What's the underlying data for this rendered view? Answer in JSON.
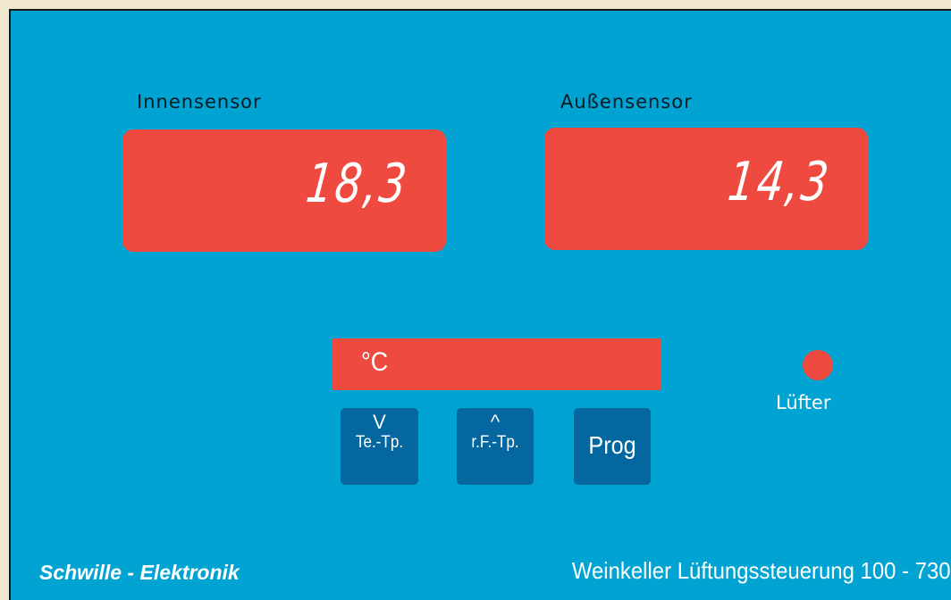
{
  "sensors": {
    "inner": {
      "label": "Innensensor",
      "value": "18,3"
    },
    "outer": {
      "label": "Außensensor",
      "value": "14,3"
    }
  },
  "unit_display": {
    "text": "°C"
  },
  "buttons": {
    "down": {
      "arrow": "V",
      "label": "Te.-Tp."
    },
    "up": {
      "arrow": "^",
      "label": "r.F.-Tp."
    },
    "prog": {
      "label": "Prog"
    }
  },
  "fan": {
    "label": "Lüfter",
    "indicator_icon": "led-dot-icon"
  },
  "footer": {
    "brand": "Schwille - Elektronik",
    "product": "Weinkeller Lüftungssteuerung 100 - 730"
  },
  "colors": {
    "panel": "#00a3d2",
    "display": "#ef4a40",
    "button": "#0467a0",
    "background": "#efe8cf"
  }
}
